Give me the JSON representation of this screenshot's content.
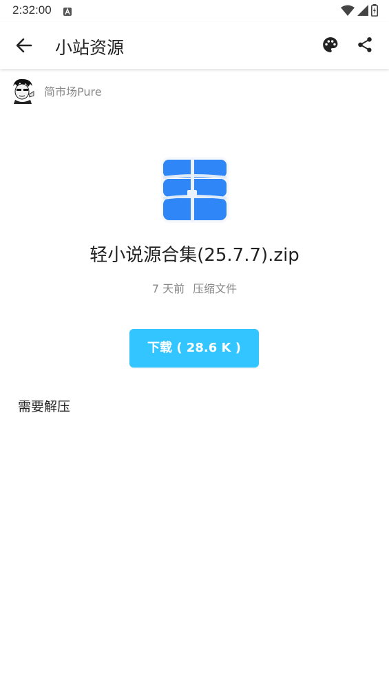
{
  "status_bar": {
    "time": "2:32:00",
    "icons": [
      "a-notification-icon",
      "wifi-icon",
      "cellular-signal-icon",
      "battery-charging-icon"
    ]
  },
  "app_bar": {
    "title": "小站资源",
    "back_icon": "arrow-left-icon",
    "actions": [
      "palette-icon",
      "share-icon"
    ]
  },
  "author": {
    "name": "简市场Pure",
    "avatar_icon": "avatar-manga-character"
  },
  "file": {
    "icon": "archive-zip-icon",
    "name": "轻小说源合集(25.7.7).zip",
    "time_ago": "7 天前",
    "type": "压缩文件"
  },
  "download": {
    "label": "下载 ( 28.6 K )"
  },
  "description": "需要解压",
  "colors": {
    "accent": "#32c5ff",
    "icon_blue": "#2f86f6",
    "text_primary": "#222222",
    "text_secondary": "#888888"
  }
}
